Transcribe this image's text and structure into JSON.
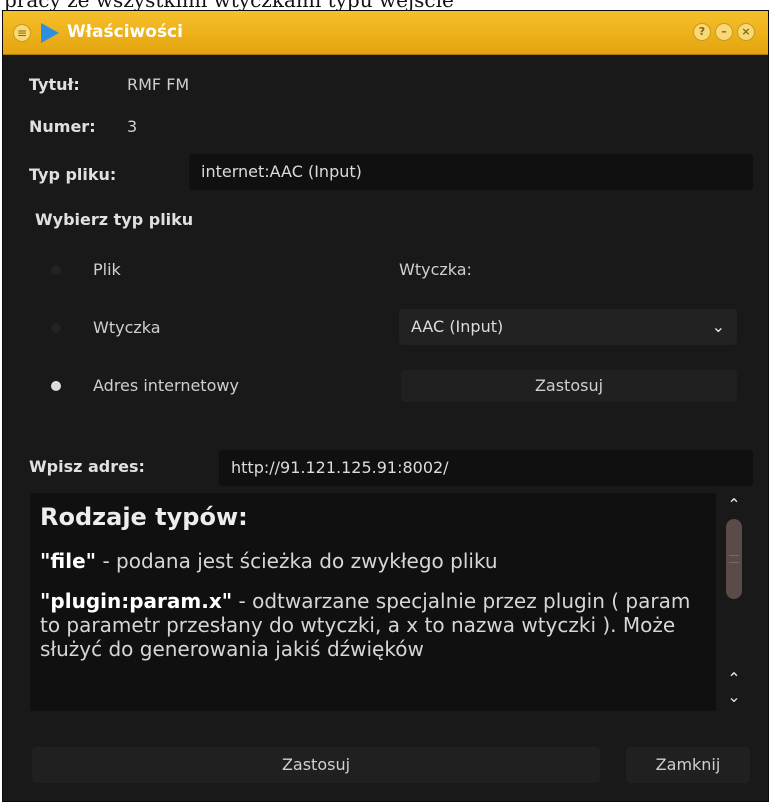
{
  "background_text": "pracy ze wszystkimi wtyczkami typu wejście",
  "window": {
    "title": "Właściwości",
    "buttons": [
      "?",
      "–",
      "×"
    ]
  },
  "info": {
    "title_label": "Tytuł:",
    "title_value": "RMF FM",
    "number_label": "Numer:",
    "number_value": "3",
    "filetype_label": "Typ pliku:",
    "filetype_value": "internet:AAC (Input)"
  },
  "choose": {
    "heading": "Wybierz typ pliku",
    "options": [
      "Plik",
      "Wtyczka",
      "Adres internetowy"
    ],
    "selected": "Adres internetowy",
    "plugin_label": "Wtyczka:",
    "plugin_select": "AAC (Input)",
    "apply_small": "Zastosuj"
  },
  "address": {
    "label": "Wpisz adres:",
    "value": "http://91.121.125.91:8002/"
  },
  "help": {
    "heading": "Rodzaje typów:",
    "file_key": "\"file\"",
    "file_desc": " - podana jest ścieżka do zwykłego pliku",
    "plugin_key": "\"plugin:param.x\"",
    "plugin_desc": " - odtwarzane specjalnie przez plugin ( param to parametr przesłany do wtyczki, a x to nazwa wtyczki ). Może służyć do generowania jakiś dźwięków"
  },
  "footer": {
    "apply": "Zastosuj",
    "close": "Zamknij"
  },
  "colors": {
    "titlebar": "#f0b21c",
    "window_bg": "#191919",
    "field_bg": "#101010",
    "scroll_thumb": "#5a4a48"
  }
}
